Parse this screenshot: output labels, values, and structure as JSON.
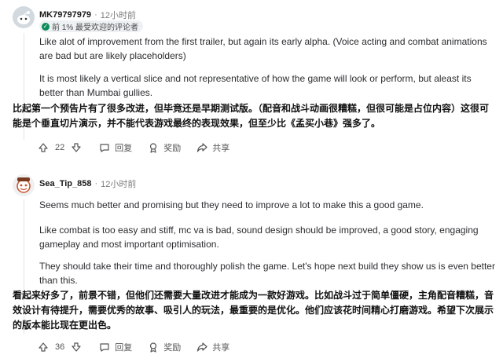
{
  "comments": [
    {
      "username": "MK79797979",
      "time": "12小时前",
      "flair": "前 1% 最受欢迎的评论者",
      "paragraphs": [
        "Like alot of improvement from the first trailer, but again its early alpha. (Voice acting and combat animations are bad but are likely placeholders)",
        "It is most likely a vertical slice and not representative of how the game will look or perform, but aleast its better than Mumbai gullies."
      ],
      "translation": "比起第一个预告片有了很多改进，但毕竟还是早期测试版。（配音和战斗动画很糟糕，但很可能是占位内容）这很可能是个垂直切片演示，并不能代表游戏最终的表现效果，但至少比《孟买小巷》强多了。",
      "votes": "22",
      "reply_label": "回复",
      "award_label": "奖励",
      "share_label": "共享"
    },
    {
      "username": "Sea_Tip_858",
      "time": "12小时前",
      "paragraphs": [
        "Seems much better and promising but they need to improve a lot to make this a good game.",
        "Like combat is too easy and stiff, mc va is bad, sound design should be improved, a good story, engaging gameplay and most important optimisation.",
        "They should take their time and thoroughly polish the game. Let's hope next build they show us is even better than this."
      ],
      "translation": "看起来好多了，前景不错，但他们还需要大量改进才能成为一款好游戏。比如战斗过于简单僵硬，主角配音糟糕，音效设计有待提升，需要优秀的故事、吸引人的玩法，最重要的是优化。他们应该花时间精心打磨游戏。希望下次展示的版本能比现在更出色。",
      "votes": "36",
      "reply_label": "回复",
      "award_label": "奖励",
      "share_label": "共享"
    }
  ],
  "icons": {
    "upvote": "upvote-arrow-icon",
    "downvote": "downvote-arrow-icon",
    "reply": "speech-bubble-icon",
    "award": "award-medal-icon",
    "share": "share-arrow-icon"
  },
  "colors": {
    "flair_badge": "#0a8c5a",
    "text": "#1a1a1b",
    "muted": "#7c7c7c"
  }
}
